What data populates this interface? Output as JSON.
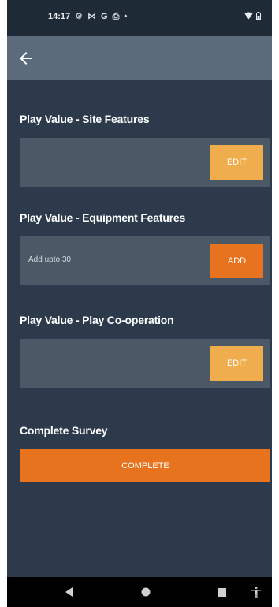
{
  "status_bar": {
    "time": "14:17",
    "left_icons": [
      "settings-icon",
      "mail-icon",
      "google-icon",
      "print-icon",
      "dot-icon"
    ],
    "right_icons": [
      "wifi-icon",
      "battery-icon"
    ]
  },
  "app_bar": {
    "back_icon": "arrow-left-icon"
  },
  "sections": [
    {
      "title": "Play Value - Site Features",
      "card_text": "",
      "button_label": "EDIT"
    },
    {
      "title": "Play Value - Equipment Features",
      "card_text": "Add upto 30",
      "button_label": "ADD"
    },
    {
      "title": "Play Value - Play Co-operation",
      "card_text": "",
      "button_label": "EDIT"
    }
  ],
  "complete": {
    "title": "Complete Survey",
    "button_label": "COMPLETE"
  },
  "colors": {
    "background": "#2c3a4b",
    "app_bar": "#5b6b7c",
    "card": "#4b5866",
    "accent_light": "#f0ad4e",
    "accent": "#e8731e"
  },
  "nav_bar": {
    "icons": [
      "nav-back-icon",
      "nav-home-icon",
      "nav-recents-icon",
      "accessibility-icon"
    ]
  }
}
